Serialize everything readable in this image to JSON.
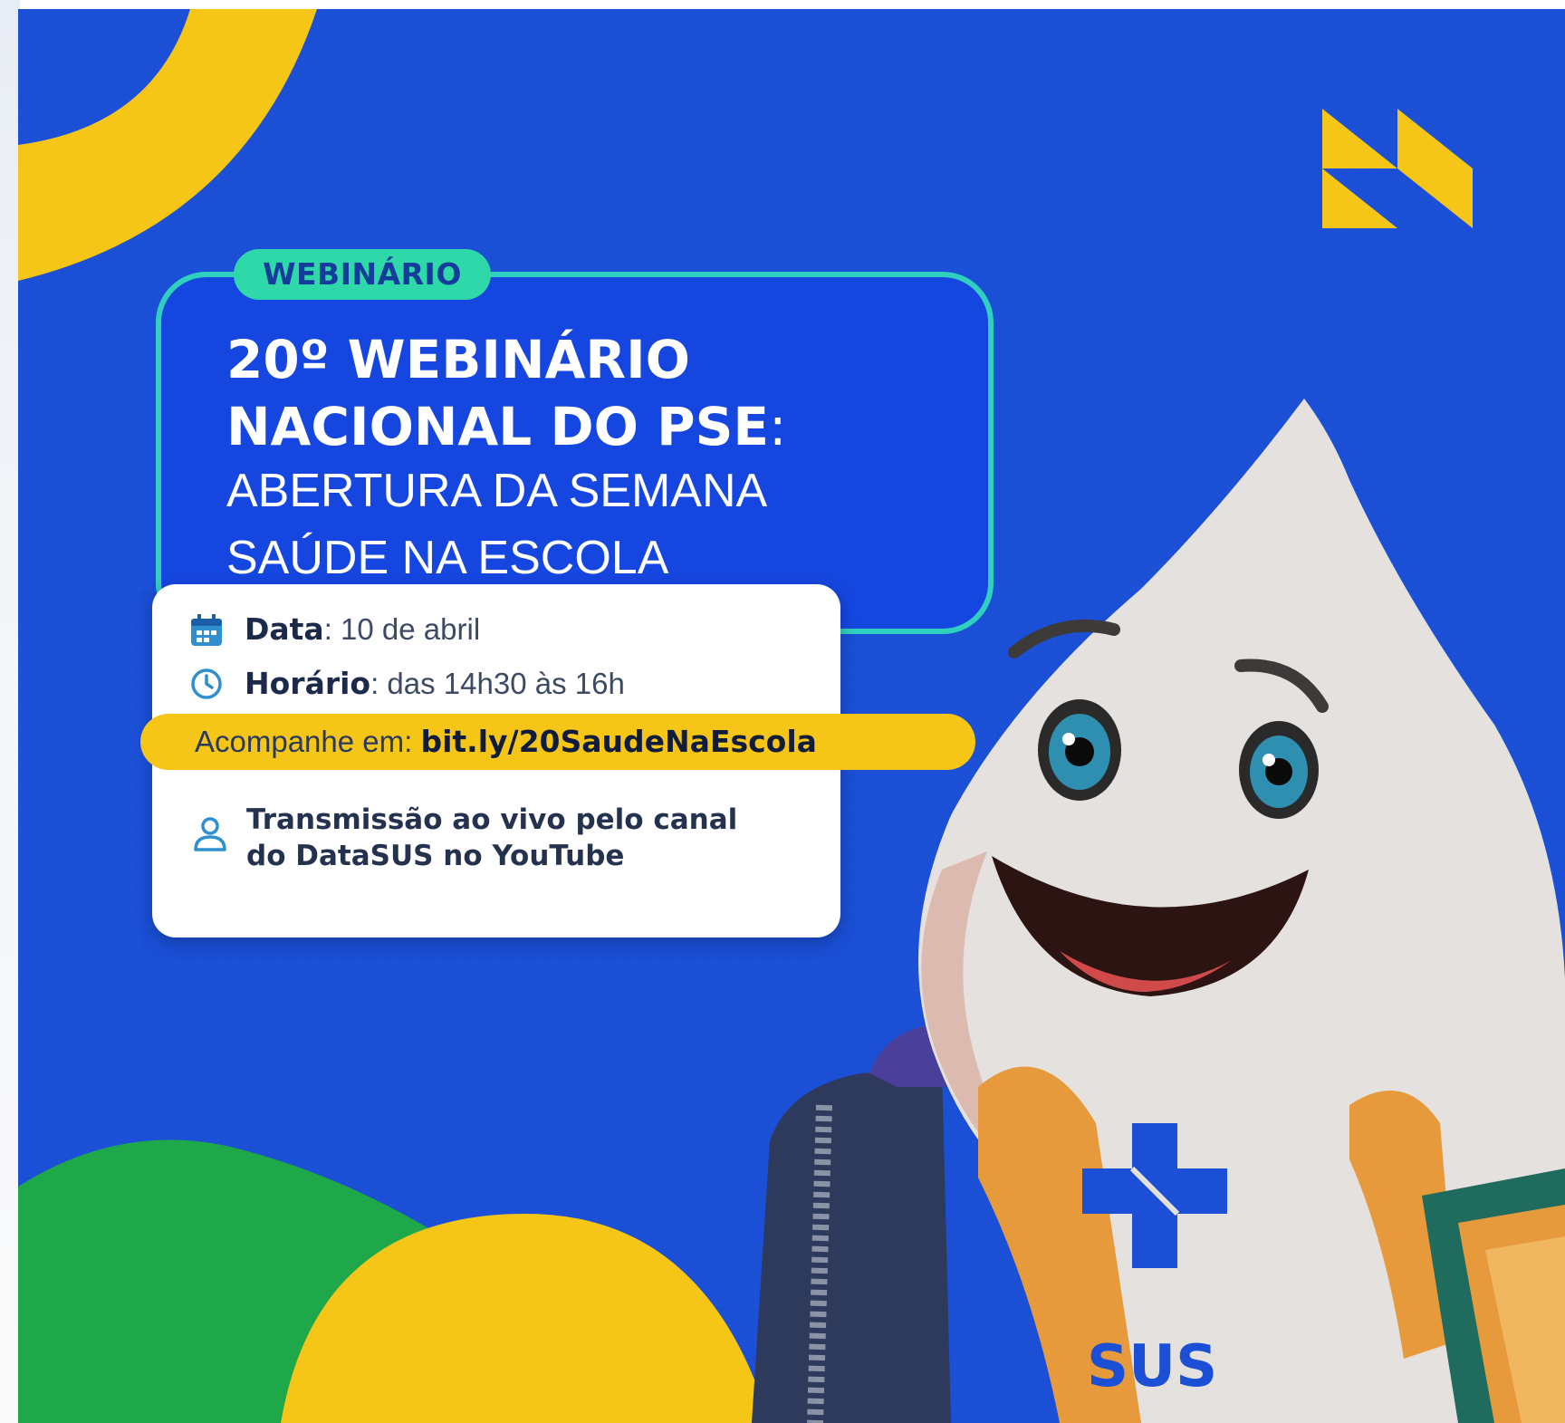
{
  "badge": "WEBINÁRIO",
  "title": {
    "line1": "20º WEBINÁRIO",
    "line2": "NACIONAL DO PSE",
    "colon": ":",
    "line3": "ABERTURA DA SEMANA",
    "line4": "SAÚDE NA ESCOLA"
  },
  "info": {
    "data_label": "Data",
    "data_value": ": 10 de abril",
    "hora_label": "Horário",
    "hora_value": ": das 14h30 às 16h",
    "follow_prefix": "Acompanhe em: ",
    "follow_link": "bit.ly/20SaudeNaEscola",
    "live_line1": "Transmissão ao vivo pelo canal",
    "live_line2": "do DataSUS no YouTube"
  },
  "mascot_chest_text": "SUS",
  "colors": {
    "background_blue": "#1a4fd6",
    "card_blue": "#1546e0",
    "teal_border": "#2fd0bd",
    "badge_green": "#2fd8a8",
    "yellow": "#f5c518",
    "green": "#1fa84a"
  },
  "icons": [
    "calendar-icon",
    "clock-icon",
    "person-icon",
    "triangles-logo-icon"
  ]
}
